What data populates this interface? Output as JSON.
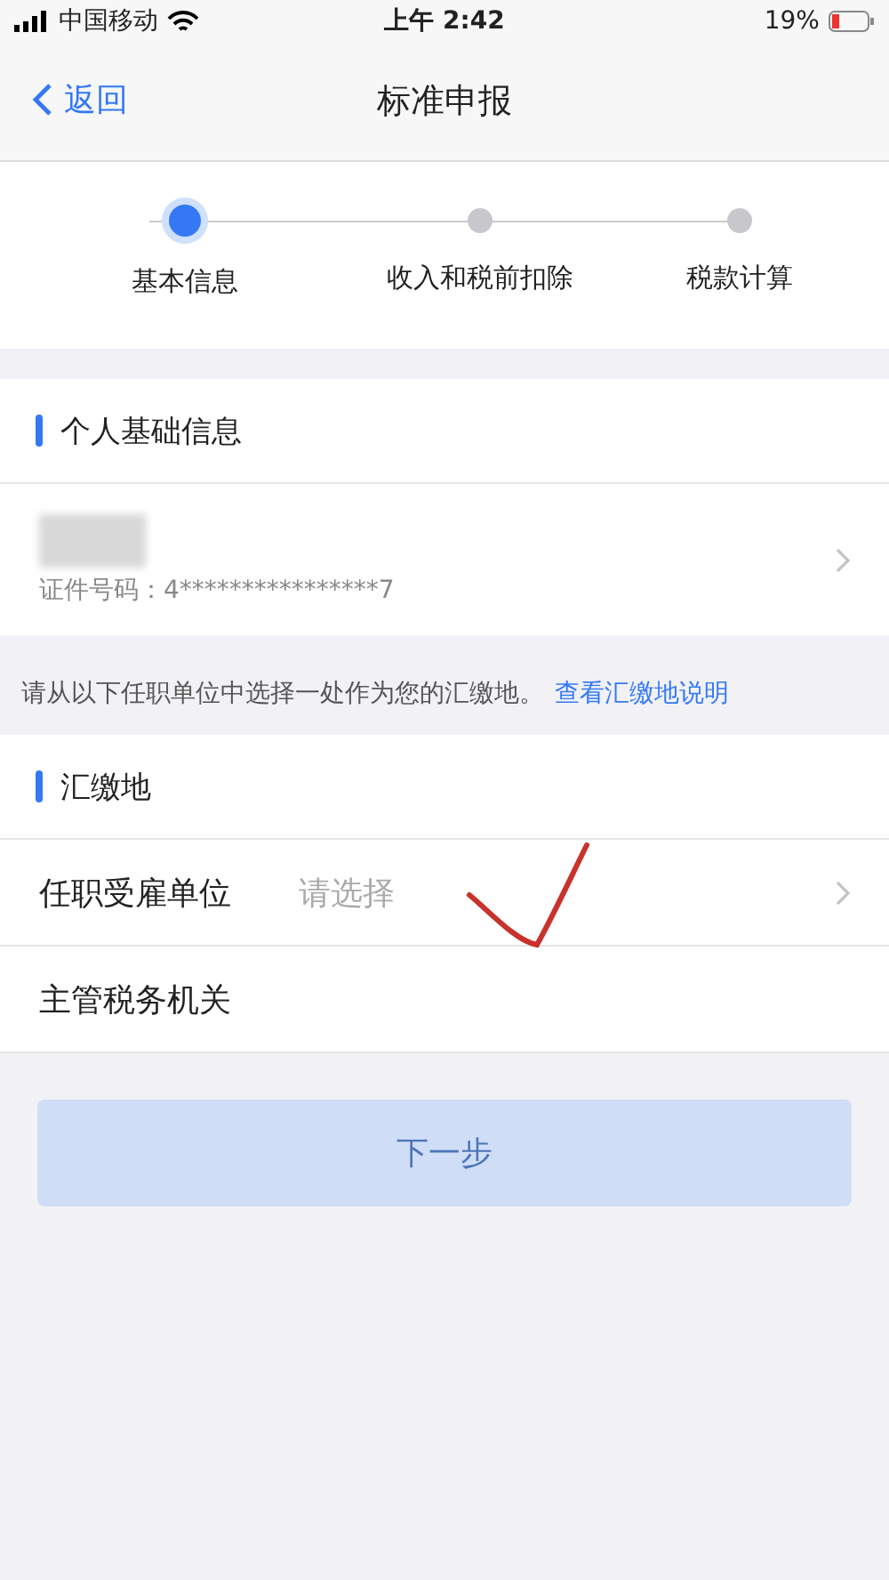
{
  "status_bar": {
    "carrier": "中国移动",
    "time": "上午 2:42",
    "battery": "19%"
  },
  "nav": {
    "back": "返回",
    "title": "标准申报"
  },
  "steps": [
    {
      "label": "基本信息",
      "selected": true
    },
    {
      "label": "收入和税前扣除",
      "selected": false
    },
    {
      "label": "税款计算",
      "selected": false
    }
  ],
  "personal": {
    "heading": "个人基础信息",
    "id_line": "证件号码：4****************7"
  },
  "notice": {
    "text": "请从以下任职单位中选择一处作为您的汇缴地。",
    "link": "查看汇缴地说明"
  },
  "payment": {
    "heading": "汇缴地",
    "rows": [
      {
        "label": "任职受雇单位",
        "placeholder": "请选择",
        "kind": "select"
      },
      {
        "label": "主管税务机关",
        "kind": "plain"
      }
    ]
  },
  "next_button": {
    "label": "下一步",
    "disabled": true
  }
}
